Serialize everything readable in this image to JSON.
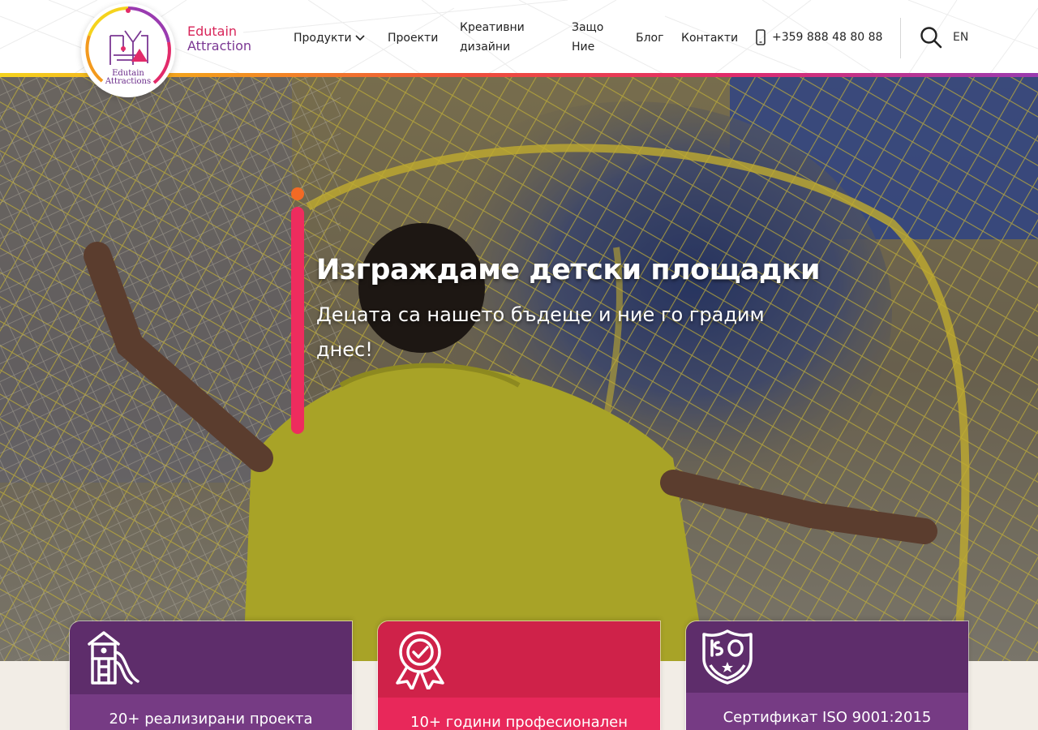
{
  "header": {
    "logo_caption_line1": "Edutain",
    "logo_caption_line2": "Attractions",
    "brand_line1": "Edutain",
    "brand_line2": "Attraction",
    "nav": {
      "products": "Продукти",
      "projects": "Проекти",
      "creative_line1": "Креативни",
      "creative_line2": "дизайни",
      "why_line1": "Защо",
      "why_line2": "Ние",
      "blog": "Блог",
      "contacts": "Контакти"
    },
    "phone": "+359 888 48 80 88",
    "language": "EN"
  },
  "hero": {
    "title": "Изграждаме детски площадки",
    "subtitle": "Децата са нашето бъдеще и ние го градим днес!"
  },
  "features": [
    {
      "label": "20+ реализирани проекта",
      "icon": "playground-tower-icon"
    },
    {
      "label": "10+ години професионален",
      "icon": "award-badge-icon"
    },
    {
      "label": "Сертификат ISO 9001:2015",
      "icon": "iso-shield-icon"
    }
  ],
  "colors": {
    "brand_red": "#d8265a",
    "brand_purple": "#7b3793",
    "accent_orange": "#f26a25",
    "accent_pink": "#ee2c5e"
  }
}
